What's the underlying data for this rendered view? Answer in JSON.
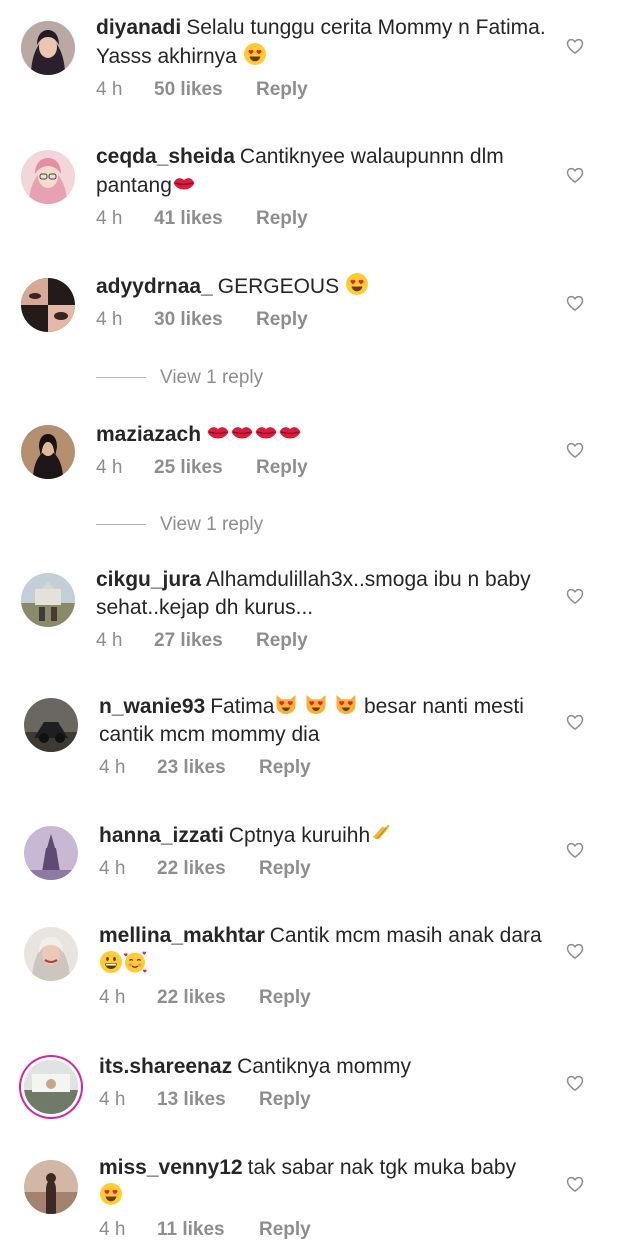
{
  "icons": {
    "heart": "heart-outline-icon",
    "heart_eyes": "heart-eyes-emoji",
    "kiss": "kiss-lips-emoji",
    "cat_heart": "heart-eyes-cat-emoji",
    "clap": "clapping-hands-emoji",
    "grin": "grinning-emoji",
    "smile_hearts": "smiling-face-with-hearts-emoji"
  },
  "comments": [
    {
      "username": "diyanadi",
      "text": "Selalu tunggu cerita Mommy n Fatima. Yasss akhirnya",
      "time": "4 h",
      "likes": "50 likes",
      "reply": "Reply"
    },
    {
      "username": "ceqda_sheida",
      "text": "Cantiknyee walaupunnn dlm pantang",
      "time": "4 h",
      "likes": "41 likes",
      "reply": "Reply"
    },
    {
      "username": "adyydrnaa_",
      "text": "GERGEOUS",
      "time": "4 h",
      "likes": "30 likes",
      "reply": "Reply",
      "view_replies": "View 1 reply"
    },
    {
      "username": "maziazach",
      "text": "",
      "time": "4 h",
      "likes": "25 likes",
      "reply": "Reply",
      "view_replies": "View 1 reply"
    },
    {
      "username": "cikgu_jura",
      "text": "Alhamdulillah3x..smoga ibu n baby sehat..kejap dh kurus...",
      "time": "4 h",
      "likes": "27 likes",
      "reply": "Reply"
    },
    {
      "username": "n_wanie93",
      "text": "Fatima",
      "text2": "besar nanti mesti cantik mcm mommy dia",
      "time": "4 h",
      "likes": "23 likes",
      "reply": "Reply"
    },
    {
      "username": "hanna_izzati",
      "text": "Cptnya kuruihh",
      "time": "4 h",
      "likes": "22 likes",
      "reply": "Reply"
    },
    {
      "username": "mellina_makhtar",
      "text": "Cantik mcm masih anak dara",
      "time": "4 h",
      "likes": "22 likes",
      "reply": "Reply"
    },
    {
      "username": "its.shareenaz",
      "text": "Cantiknya mommy",
      "time": "4 h",
      "likes": "13 likes",
      "reply": "Reply"
    },
    {
      "username": "miss_venny12",
      "text": "tak sabar nak tgk muka baby",
      "time": "4 h",
      "likes": "11 likes",
      "reply": "Reply"
    }
  ]
}
